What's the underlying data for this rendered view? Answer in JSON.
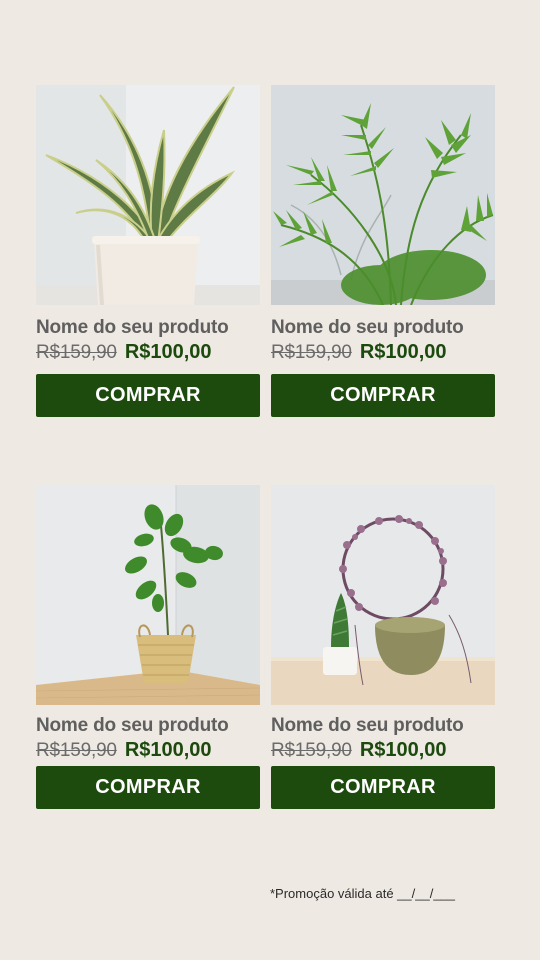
{
  "products": [
    {
      "name": "Nome do seu produto",
      "old_price": "R$159,90",
      "price": "R$100,00",
      "button": "COMPRAR",
      "image": "snake-plant-photo"
    },
    {
      "name": "Nome do seu produto",
      "old_price": "R$159,90",
      "price": "R$100,00",
      "button": "COMPRAR",
      "image": "palm-plant-photo"
    },
    {
      "name": "Nome do seu produto",
      "old_price": "R$159,90",
      "price": "R$100,00",
      "button": "COMPRAR",
      "image": "fiddle-leaf-fig-photo"
    },
    {
      "name": "Nome do seu produto",
      "old_price": "R$159,90",
      "price": "R$100,00",
      "button": "COMPRAR",
      "image": "string-of-hearts-photo"
    }
  ],
  "footer": {
    "promo_note": "*Promoção válida até __/__/___"
  },
  "colors": {
    "background": "#efe9e3",
    "button": "#1d4a0d",
    "price": "#1c4a0e",
    "text": "#5f5f5f"
  }
}
